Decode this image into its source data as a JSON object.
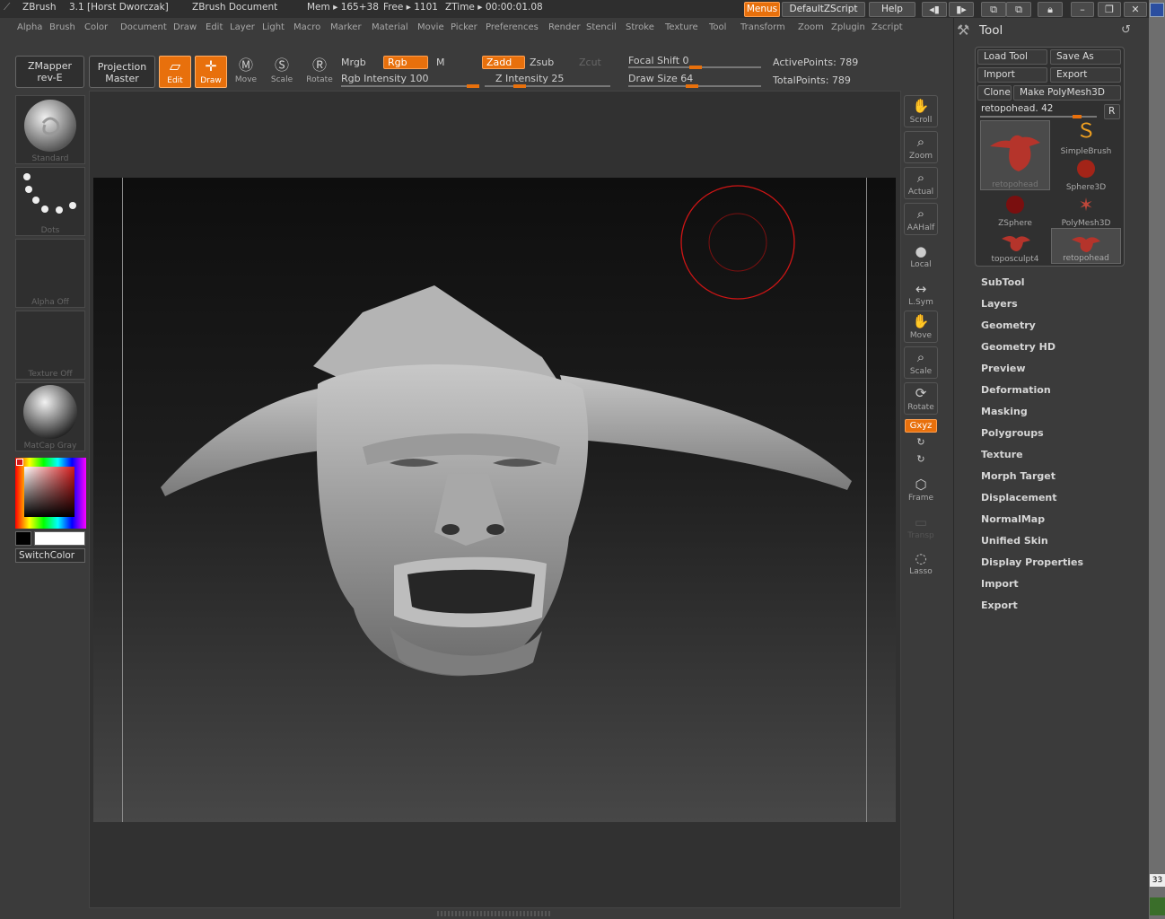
{
  "titlebar": {
    "app": "ZBrush",
    "version": "3.1 [Horst Dworczak]",
    "document": "ZBrush Document",
    "mem": "Mem ▸ 165+38",
    "free": "Free ▸ 1101",
    "ztime": "ZTime ▸ 00:00:01.08",
    "menus_btn": "Menus",
    "script_btn": "DefaultZScript",
    "help_btn": "Help"
  },
  "menubar": [
    "Alpha",
    "Brush",
    "Color",
    "Document",
    "Draw",
    "Edit",
    "Layer",
    "Light",
    "Macro",
    "Marker",
    "Material",
    "Movie",
    "Picker",
    "Preferences",
    "Render",
    "Stencil",
    "Stroke",
    "Texture",
    "Tool",
    "Transform",
    "Zoom",
    "Zplugin",
    "Zscript"
  ],
  "shelf": {
    "zmapper_1": "ZMapper",
    "zmapper_2": "rev-E",
    "projection_1": "Projection",
    "projection_2": "Master",
    "edit": "Edit",
    "draw": "Draw",
    "move": "Move",
    "scale": "Scale",
    "rotate": "Rotate",
    "mrgb": "Mrgb",
    "rgb": "Rgb",
    "m": "M",
    "zadd": "Zadd",
    "zsub": "Zsub",
    "zcut": "Zcut",
    "rgb_intensity": "Rgb Intensity 100",
    "z_intensity": "Z Intensity 25",
    "focal_shift": "Focal Shift 0",
    "draw_size": "Draw Size 64",
    "active_points": "ActivePoints: 789",
    "total_points": "TotalPoints: 789"
  },
  "left_tray": {
    "brush": "Standard",
    "stroke": "Dots",
    "alpha": "Alpha Off",
    "texture": "Texture Off",
    "material": "MatCap Gray",
    "switch_color": "SwitchColor"
  },
  "right_shelf": {
    "scroll": "Scroll",
    "zoom": "Zoom",
    "actual": "Actual",
    "aahalf": "AAHalf",
    "local": "Local",
    "lsym": "L.Sym",
    "move": "Move",
    "scale": "Scale",
    "rotate": "Rotate",
    "xyz": "Gxyz",
    "frame": "Frame",
    "transp": "Transp",
    "lasso": "Lasso"
  },
  "tool_palette": {
    "title": "Tool",
    "load_tool": "Load Tool",
    "save_as": "Save As",
    "import": "Import",
    "export": "Export",
    "clone": "Clone",
    "make_polymesh": "Make PolyMesh3D",
    "current_tool": "retopohead. 42",
    "r_btn": "R",
    "tools": [
      "retopohead",
      "SimpleBrush",
      "Sphere3D",
      "ZSphere",
      "PolyMesh3D",
      "toposculpt4",
      "retopohead"
    ],
    "sections": [
      "SubTool",
      "Layers",
      "Geometry",
      "Geometry HD",
      "Preview",
      "Deformation",
      "Masking",
      "Polygroups",
      "Texture",
      "Morph Target",
      "Displacement",
      "NormalMap",
      "Unified Skin",
      "Display Properties",
      "Import",
      "Export"
    ]
  },
  "taskbar": {
    "clock": "33"
  },
  "colors": {
    "accent": "#e8700c",
    "bg": "#3b3b3b",
    "brush_ring": "#d01515"
  }
}
